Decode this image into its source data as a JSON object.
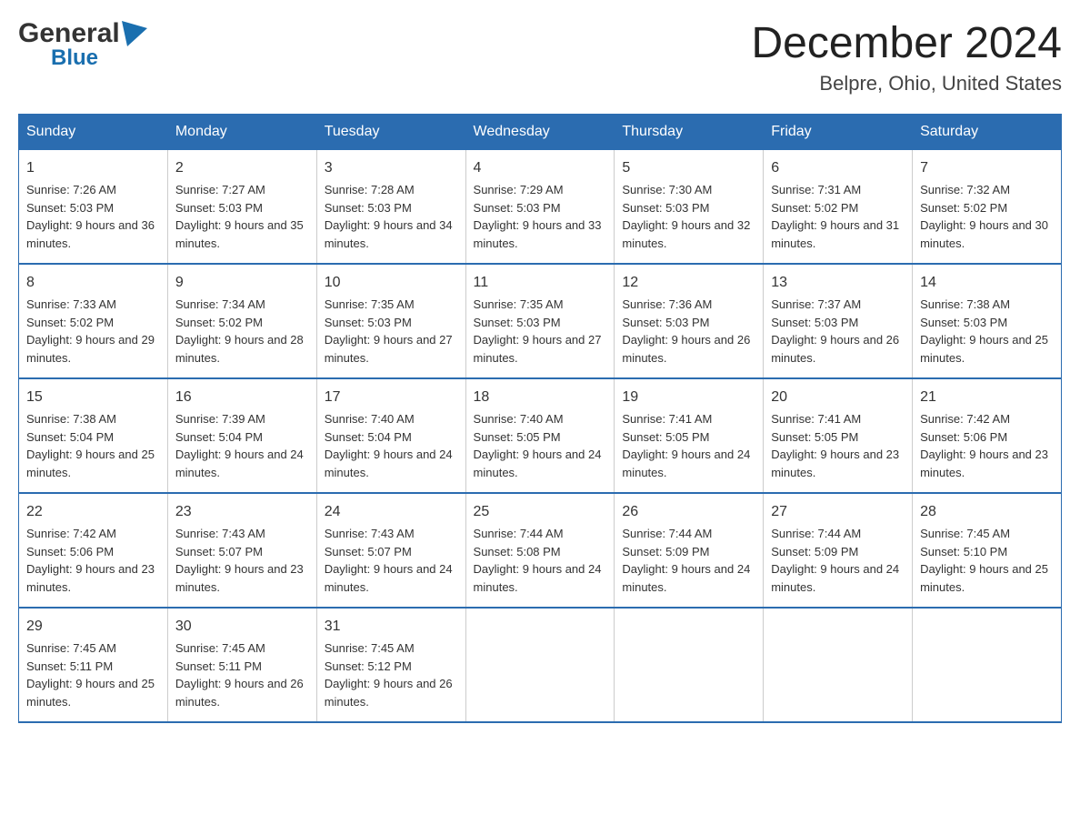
{
  "logo": {
    "general": "General",
    "blue": "Blue"
  },
  "title": {
    "month": "December 2024",
    "location": "Belpre, Ohio, United States"
  },
  "days_header": [
    "Sunday",
    "Monday",
    "Tuesday",
    "Wednesday",
    "Thursday",
    "Friday",
    "Saturday"
  ],
  "weeks": [
    [
      {
        "day": "1",
        "sunrise": "7:26 AM",
        "sunset": "5:03 PM",
        "daylight": "9 hours and 36 minutes."
      },
      {
        "day": "2",
        "sunrise": "7:27 AM",
        "sunset": "5:03 PM",
        "daylight": "9 hours and 35 minutes."
      },
      {
        "day": "3",
        "sunrise": "7:28 AM",
        "sunset": "5:03 PM",
        "daylight": "9 hours and 34 minutes."
      },
      {
        "day": "4",
        "sunrise": "7:29 AM",
        "sunset": "5:03 PM",
        "daylight": "9 hours and 33 minutes."
      },
      {
        "day": "5",
        "sunrise": "7:30 AM",
        "sunset": "5:03 PM",
        "daylight": "9 hours and 32 minutes."
      },
      {
        "day": "6",
        "sunrise": "7:31 AM",
        "sunset": "5:02 PM",
        "daylight": "9 hours and 31 minutes."
      },
      {
        "day": "7",
        "sunrise": "7:32 AM",
        "sunset": "5:02 PM",
        "daylight": "9 hours and 30 minutes."
      }
    ],
    [
      {
        "day": "8",
        "sunrise": "7:33 AM",
        "sunset": "5:02 PM",
        "daylight": "9 hours and 29 minutes."
      },
      {
        "day": "9",
        "sunrise": "7:34 AM",
        "sunset": "5:02 PM",
        "daylight": "9 hours and 28 minutes."
      },
      {
        "day": "10",
        "sunrise": "7:35 AM",
        "sunset": "5:03 PM",
        "daylight": "9 hours and 27 minutes."
      },
      {
        "day": "11",
        "sunrise": "7:35 AM",
        "sunset": "5:03 PM",
        "daylight": "9 hours and 27 minutes."
      },
      {
        "day": "12",
        "sunrise": "7:36 AM",
        "sunset": "5:03 PM",
        "daylight": "9 hours and 26 minutes."
      },
      {
        "day": "13",
        "sunrise": "7:37 AM",
        "sunset": "5:03 PM",
        "daylight": "9 hours and 26 minutes."
      },
      {
        "day": "14",
        "sunrise": "7:38 AM",
        "sunset": "5:03 PM",
        "daylight": "9 hours and 25 minutes."
      }
    ],
    [
      {
        "day": "15",
        "sunrise": "7:38 AM",
        "sunset": "5:04 PM",
        "daylight": "9 hours and 25 minutes."
      },
      {
        "day": "16",
        "sunrise": "7:39 AM",
        "sunset": "5:04 PM",
        "daylight": "9 hours and 24 minutes."
      },
      {
        "day": "17",
        "sunrise": "7:40 AM",
        "sunset": "5:04 PM",
        "daylight": "9 hours and 24 minutes."
      },
      {
        "day": "18",
        "sunrise": "7:40 AM",
        "sunset": "5:05 PM",
        "daylight": "9 hours and 24 minutes."
      },
      {
        "day": "19",
        "sunrise": "7:41 AM",
        "sunset": "5:05 PM",
        "daylight": "9 hours and 24 minutes."
      },
      {
        "day": "20",
        "sunrise": "7:41 AM",
        "sunset": "5:05 PM",
        "daylight": "9 hours and 23 minutes."
      },
      {
        "day": "21",
        "sunrise": "7:42 AM",
        "sunset": "5:06 PM",
        "daylight": "9 hours and 23 minutes."
      }
    ],
    [
      {
        "day": "22",
        "sunrise": "7:42 AM",
        "sunset": "5:06 PM",
        "daylight": "9 hours and 23 minutes."
      },
      {
        "day": "23",
        "sunrise": "7:43 AM",
        "sunset": "5:07 PM",
        "daylight": "9 hours and 23 minutes."
      },
      {
        "day": "24",
        "sunrise": "7:43 AM",
        "sunset": "5:07 PM",
        "daylight": "9 hours and 24 minutes."
      },
      {
        "day": "25",
        "sunrise": "7:44 AM",
        "sunset": "5:08 PM",
        "daylight": "9 hours and 24 minutes."
      },
      {
        "day": "26",
        "sunrise": "7:44 AM",
        "sunset": "5:09 PM",
        "daylight": "9 hours and 24 minutes."
      },
      {
        "day": "27",
        "sunrise": "7:44 AM",
        "sunset": "5:09 PM",
        "daylight": "9 hours and 24 minutes."
      },
      {
        "day": "28",
        "sunrise": "7:45 AM",
        "sunset": "5:10 PM",
        "daylight": "9 hours and 25 minutes."
      }
    ],
    [
      {
        "day": "29",
        "sunrise": "7:45 AM",
        "sunset": "5:11 PM",
        "daylight": "9 hours and 25 minutes."
      },
      {
        "day": "30",
        "sunrise": "7:45 AM",
        "sunset": "5:11 PM",
        "daylight": "9 hours and 26 minutes."
      },
      {
        "day": "31",
        "sunrise": "7:45 AM",
        "sunset": "5:12 PM",
        "daylight": "9 hours and 26 minutes."
      },
      null,
      null,
      null,
      null
    ]
  ],
  "colors": {
    "header_bg": "#2b6cb0",
    "header_text": "#ffffff",
    "border": "#2b6cb0"
  }
}
